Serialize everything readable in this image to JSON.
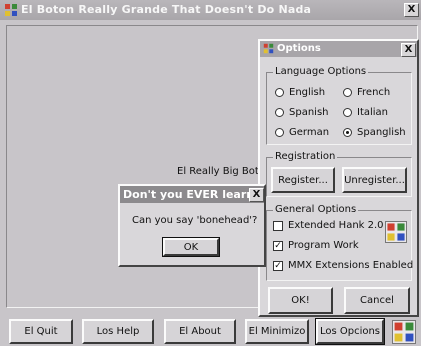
{
  "window": {
    "title": "El Boton Really Grande That Doesn't Do Nada",
    "close_label": "X"
  },
  "big_button": {
    "label": "El Really Big Boton"
  },
  "bottom_bar": {
    "buttons": [
      "El Quit",
      "Los Help",
      "El About",
      "El Minimizo",
      "Los Opcions"
    ]
  },
  "options": {
    "title": "Options",
    "close_label": "X",
    "language": {
      "label": "Language Options",
      "items": [
        {
          "label": "English",
          "selected": false
        },
        {
          "label": "French",
          "selected": false
        },
        {
          "label": "Spanish",
          "selected": false
        },
        {
          "label": "Italian",
          "selected": false
        },
        {
          "label": "German",
          "selected": false
        },
        {
          "label": "Spanglish",
          "selected": true
        }
      ]
    },
    "registration": {
      "label": "Registration",
      "register": "Register...",
      "unregister": "Unregister..."
    },
    "general": {
      "label": "General Options",
      "items": [
        {
          "label": "Extended Hank 2.0",
          "checked": false
        },
        {
          "label": "Program Work",
          "checked": true
        },
        {
          "label": "MMX Extensions Enabled",
          "checked": true
        }
      ]
    },
    "ok": "OK!",
    "cancel": "Cancel"
  },
  "alert": {
    "title": "Don't you EVER learn?",
    "close_label": "X",
    "message": "Can you say 'bonehead'?",
    "ok": "OK"
  },
  "icons": [
    "app-icon",
    "puzzle-icon",
    "close-icon"
  ],
  "colors": {
    "titlebar": "#aeabaf",
    "desktop": "#c8c5c9",
    "dialog_title": "#8c8a8d"
  }
}
